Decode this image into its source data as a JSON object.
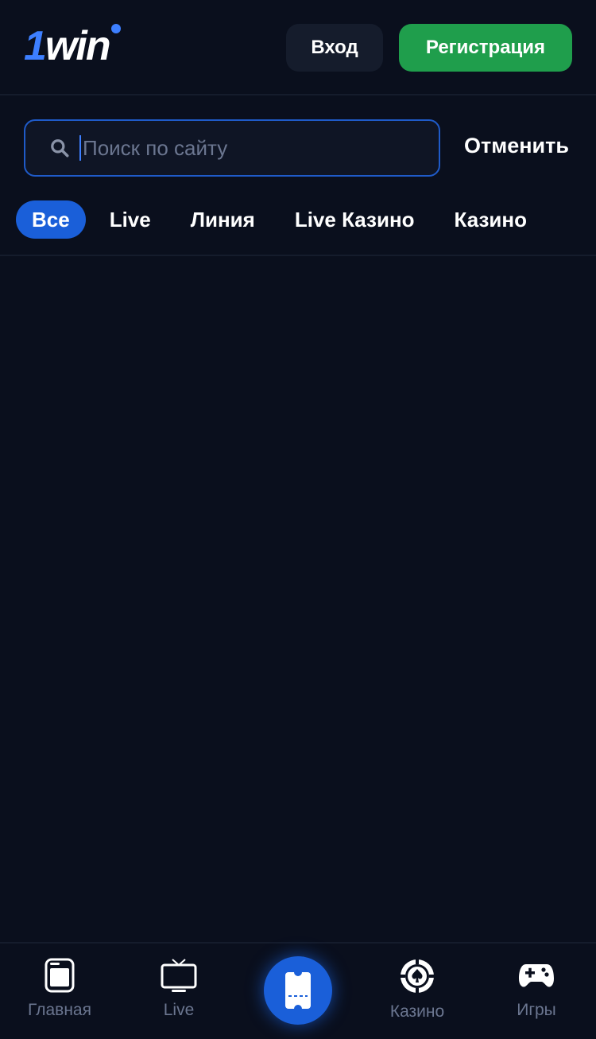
{
  "header": {
    "logo_prefix": "1",
    "logo_text": "win",
    "login_label": "Вход",
    "register_label": "Регистрация"
  },
  "search": {
    "placeholder": "Поиск по сайту",
    "value": "",
    "cancel_label": "Отменить"
  },
  "tabs": [
    {
      "label": "Все",
      "active": true
    },
    {
      "label": "Live",
      "active": false
    },
    {
      "label": "Линия",
      "active": false
    },
    {
      "label": "Live Казино",
      "active": false
    },
    {
      "label": "Казино",
      "active": false
    }
  ],
  "bottom_nav": {
    "items": [
      {
        "label": "Главная",
        "icon": "home-icon"
      },
      {
        "label": "Live",
        "icon": "tv-icon"
      },
      {
        "label": "",
        "icon": "ticket-icon"
      },
      {
        "label": "Казино",
        "icon": "casino-chip-icon"
      },
      {
        "label": "Игры",
        "icon": "gamepad-icon"
      }
    ]
  },
  "colors": {
    "background": "#0a0f1d",
    "accent": "#1a5fd9",
    "register": "#1f9e4c",
    "muted": "#6b7690"
  }
}
